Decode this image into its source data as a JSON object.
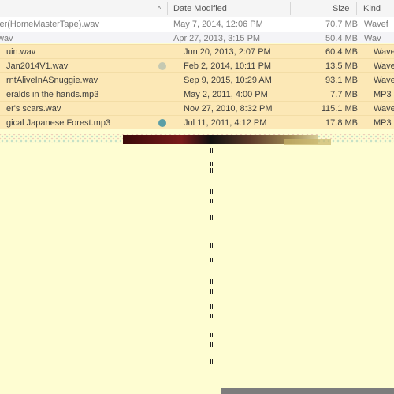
{
  "header": {
    "date_modified": "Date Modified",
    "size": "Size",
    "kind": "Kind",
    "sort_indicator": "^"
  },
  "rows_plain": [
    {
      "name": "ier(HomeMasterTape).wav",
      "date": "May 7, 2014, 12:06 PM",
      "size": "70.7 MB",
      "kind": "Wavef"
    },
    {
      "name": "wav",
      "date": "Apr 27, 2013, 3:15 PM",
      "size": "50.4 MB",
      "kind": "Wav"
    }
  ],
  "rows_selected": [
    {
      "name": "uin.wav",
      "date": "Jun 20, 2013, 2:07 PM",
      "size": "60.4 MB",
      "kind": "Wave",
      "tag_color": ""
    },
    {
      "name": "Jan2014V1.wav",
      "date": "Feb 2, 2014, 10:11 PM",
      "size": "13.5 MB",
      "kind": "Wave",
      "tag_color": "#c5c9b2"
    },
    {
      "name": "rntAliveInASnuggie.wav",
      "date": "Sep 9, 2015, 10:29 AM",
      "size": "93.1 MB",
      "kind": "Wave",
      "tag_color": ""
    },
    {
      "name": "eralds in the hands.mp3",
      "date": "May 2, 2011, 4:00 PM",
      "size": "7.7 MB",
      "kind": "MP3",
      "tag_color": ""
    },
    {
      "name": "er's scars.wav",
      "date": "Nov 27, 2010, 8:32 PM",
      "size": "115.1 MB",
      "kind": "Wave",
      "tag_color": ""
    },
    {
      "name": "gical Japanese Forest.mp3",
      "date": "Jul 11, 2011, 4:12 PM",
      "size": "17.8 MB",
      "kind": "MP3",
      "tag_color": "#5b9ea6"
    }
  ],
  "colors": {
    "selection": "#fce8b6",
    "background": "#fefdd2"
  }
}
